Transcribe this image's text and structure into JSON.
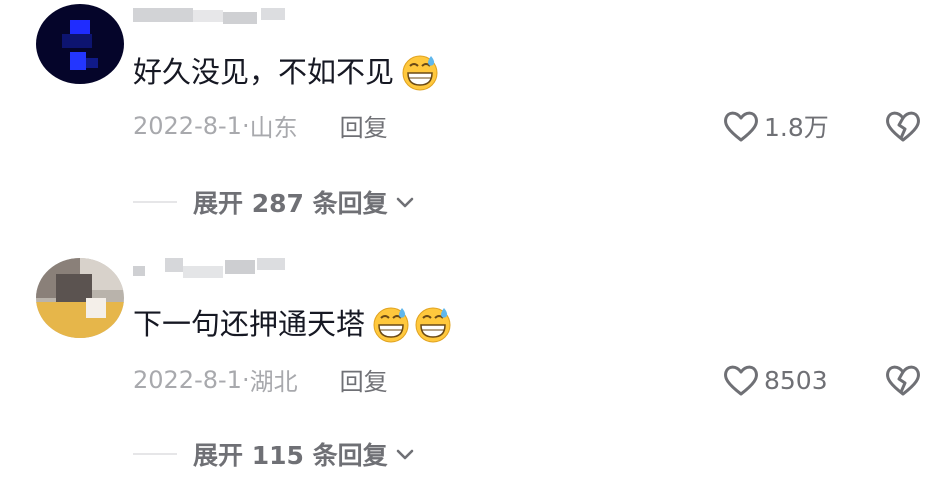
{
  "comments": [
    {
      "text": "好久没见，不如不见",
      "date": "2022-8-1·",
      "location": "山东",
      "reply_label": "回复",
      "like_count": "1.8万",
      "expand_label": "展开 287 条回复",
      "emoji_icons": [
        "grinning-sweat-face-icon"
      ]
    },
    {
      "text": "下一句还押通天塔",
      "date": "2022-8-1·",
      "location": "湖北",
      "reply_label": "回复",
      "like_count": "8503",
      "expand_label": "展开 115 条回复",
      "emoji_icons": [
        "grinning-sweat-face-icon",
        "grinning-sweat-face-icon"
      ]
    }
  ],
  "colors": {
    "text_primary": "#161823",
    "text_meta": "#a8a9ad",
    "text_secondary": "#6f7075",
    "emoji_face": "#ffc83d",
    "sweat": "#5fb7ec"
  }
}
